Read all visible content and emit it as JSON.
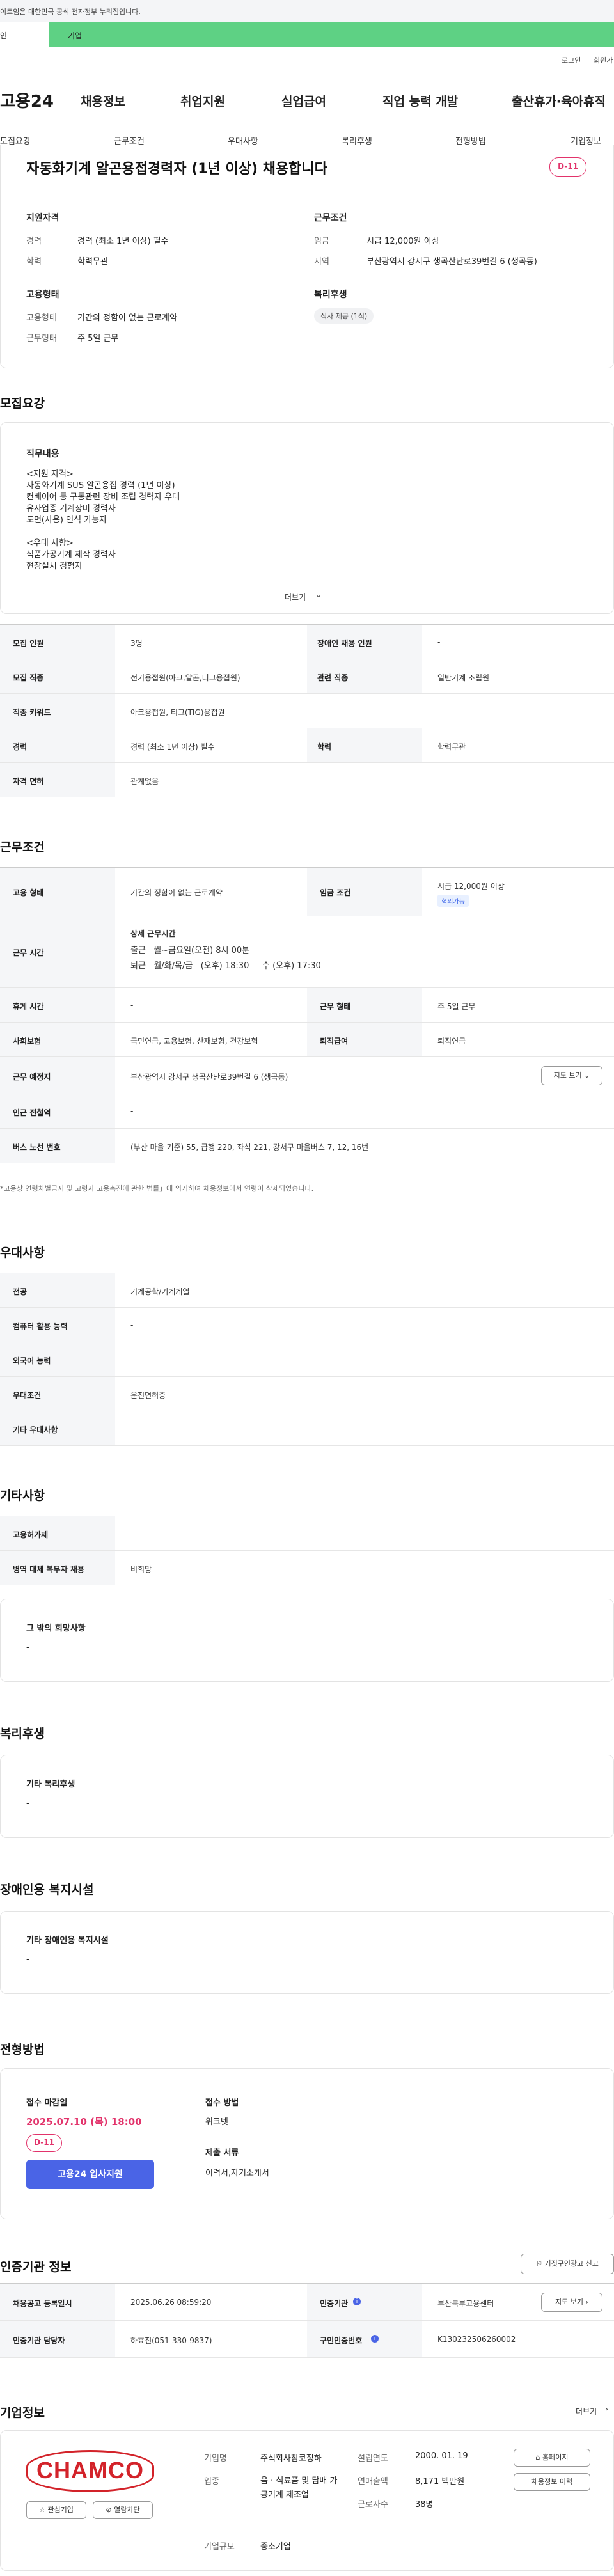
{
  "banner": {
    "text": "이트임은 대한민국 공식 전자정부 누리집입니다."
  },
  "green": {
    "left": "인",
    "right": "기업"
  },
  "util": {
    "login": "로그인",
    "join": "회원가"
  },
  "gnb": {
    "logo": "고용24",
    "menu": [
      "채용정보",
      "취업지원",
      "실업급여",
      "직업 능력 개발",
      "출산휴가·육아휴직"
    ]
  },
  "subnav": [
    "모집요강",
    "근무조건",
    "우대사항",
    "복리후생",
    "전형방법",
    "기업정보"
  ],
  "summary": {
    "title": "자동화기계 알곤용접경력자 (1년 이상) 채용합니다",
    "dday": "D-11",
    "qual_title": "지원자격",
    "qual": [
      {
        "label": "경력",
        "value": "경력 (최소 1년 이상) 필수"
      },
      {
        "label": "학력",
        "value": "학력무관"
      }
    ],
    "cond_title": "근무조건",
    "cond": [
      {
        "label": "임금",
        "value": "시급 12,000원 이상"
      },
      {
        "label": "지역",
        "value": "부산광역시 강서구 생곡산단로39번길 6 (생곡동)"
      }
    ],
    "emp_title": "고용형태",
    "emp": [
      {
        "label": "고용형태",
        "value": "기간의 정함이 없는 근로계약"
      },
      {
        "label": "근무형태",
        "value": "주 5일 근무"
      }
    ],
    "welfare_title": "복리후생",
    "welfare_chip": "식사 제공 (1식)"
  },
  "recruit": {
    "section": "모집요강",
    "job_title": "직무내용",
    "job_lines": [
      "<지원 자격>",
      "자동화기계 SUS 알곤용접 경력 (1년 이상)",
      "컨베이어 등 구동관련 장비 조립 경력자 우대",
      "유사업종 기계장비 경력자",
      "도면(사용) 인식 가능자",
      "",
      "<우대 사항>",
      "식품가공기계 제작 경력자",
      "현장설치 경험자"
    ],
    "more": "더보기",
    "rows": [
      {
        "l1": "모집 인원",
        "v1": "3명",
        "l2": "장애인 채용 인원",
        "v2": "-"
      },
      {
        "l1": "모집 직종",
        "v1": "전기용접원(아크,알곤,티그용접원)",
        "l2": "관련 직종",
        "v2": "일반기계 조립원"
      },
      {
        "l1": "직종 키워드",
        "v1": "아크용접원, 티그(TIG)용접원",
        "l2": "",
        "v2": ""
      },
      {
        "l1": "경력",
        "v1": "경력 (최소 1년 이상) 필수",
        "l2": "학력",
        "v2": "학력무관"
      },
      {
        "l1": "자격 면허",
        "v1": "관계없음",
        "l2": "",
        "v2": ""
      }
    ]
  },
  "work": {
    "section": "근무조건",
    "emp_label": "고용 형태",
    "emp_value": "기간의 정함이 없는 근로계약",
    "wage_label": "임금 조건",
    "wage_value": "시급 12,000원 이상",
    "wage_badge": "협의가능",
    "hours_label": "근무 시간",
    "hours_title": "상세 근무시간",
    "hours_lines": [
      "출근   월~금요일(오전) 8시 00분",
      "퇴근   월/화/목/금   (오후) 18:30     수 (오후) 17:30"
    ],
    "holiday_label": "휴게 시간",
    "holiday_value": "-",
    "form_label": "근무 형태",
    "form_value": "주 5일 근무",
    "ins_label": "사회보험",
    "ins_value": "국민연금, 고용보험, 산재보험, 건강보험",
    "ret_label": "퇴직급여",
    "ret_value": "퇴직연금",
    "place_label": "근무 예정지",
    "place_value": "부산광역시 강서구 생곡산단로39번길 6 (생곡동)",
    "map_btn": "지도 보기",
    "subway_label": "인근 전철역",
    "subway_value": "-",
    "bus_label": "버스 노선 번호",
    "bus_value": "(부산 마을 기준) 55, 급행 220, 좌석 221, 강서구 마을버스 7, 12, 16번",
    "note": "*고용상 연령차별금지 및 고령자 고용촉진에 관한 법률」에 의거하여 채용정보에서 연령이 삭제되었습니다."
  },
  "pref": {
    "section": "우대사항",
    "rows": [
      {
        "l": "전공",
        "v": "기계공학/기계계열"
      },
      {
        "l": "컴퓨터 활용 능력",
        "v": "-"
      },
      {
        "l": "외국어 능력",
        "v": "-"
      },
      {
        "l": "우대조건",
        "v": "운전면허증"
      },
      {
        "l": "기타 우대사항",
        "v": "-"
      }
    ]
  },
  "etc": {
    "section": "기타사항",
    "rows": [
      {
        "l": "고용허가제",
        "v": "-"
      },
      {
        "l": "병역 대체 복무자 채용",
        "v": "비희망"
      }
    ],
    "box_title": "그 밖의 희망사항",
    "box_value": "-"
  },
  "welfare": {
    "section": "복리후생",
    "box_title": "기타 복리후생",
    "box_value": "-"
  },
  "disabled": {
    "section": "장애인용 복지시설",
    "box_title": "기타 장애인용 복지시설",
    "box_value": "-"
  },
  "process": {
    "section": "전형방법",
    "deadline_label": "접수 마감일",
    "deadline_value": "2025.07.10 (목) 18:00",
    "dday": "D-11",
    "apply_btn": "고용24 입사지원",
    "method_label": "접수 방법",
    "method_value": "워크넷",
    "docs_label": "제출 서류",
    "docs_value": "이력서,자기소개서"
  },
  "agency": {
    "section": "인증기관 정보",
    "report_btn": "거짓구인광고 신고",
    "r1": {
      "l1": "채용공고 등록일시",
      "v1": "2025.06.26 08:59:20",
      "l2": "인증기관",
      "v2": "부산북부고용센터",
      "btn": "지도 보기"
    },
    "r2": {
      "l1": "인증기관 담당자",
      "v1": "하효진(051-330-9837)",
      "l2": "구인인증번호",
      "v2": "K130232506260002"
    }
  },
  "company": {
    "section": "기업정보",
    "more": "더보기",
    "logo_text": "CHAMCO",
    "fav_btn": "관심기업",
    "block_btn": "열람차단",
    "name_label": "기업명",
    "name_value": "주식회사참코정하",
    "industry_label": "업종",
    "industry_value": "음 · 식료품 및 담배 가공기계 제조업",
    "size_label": "기업규모",
    "size_value": "중소기업",
    "founded_label": "설립연도",
    "founded_value": "2000. 01. 19",
    "sales_label": "연매출액",
    "sales_value": "8,171 백만원",
    "emp_label": "근로자수",
    "emp_value": "38명",
    "home_btn": "홈페이지",
    "list_btn": "채용정보 이력"
  }
}
